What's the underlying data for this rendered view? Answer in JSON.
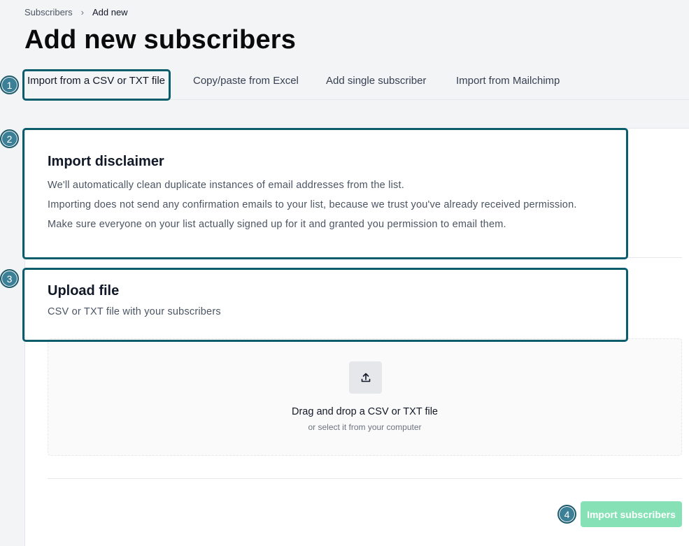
{
  "breadcrumb": {
    "parent": "Subscribers",
    "separator": "›",
    "current": "Add new"
  },
  "page": {
    "title": "Add new subscribers"
  },
  "tabs": [
    {
      "label": "Import from a CSV or TXT file"
    },
    {
      "label": "Copy/paste from Excel"
    },
    {
      "label": "Add single subscriber"
    },
    {
      "label": "Import from Mailchimp"
    }
  ],
  "disclaimer": {
    "title": "Import disclaimer",
    "lines": [
      "We'll automatically clean duplicate instances of email addresses from the list.",
      "Importing does not send any confirmation emails to your list, because we trust you've already received permission.",
      "Make sure everyone on your list actually signed up for it and granted you permission to email them."
    ]
  },
  "upload": {
    "title": "Upload file",
    "subtitle": "CSV or TXT file with your subscribers",
    "drop_title": "Drag and drop a CSV or TXT file",
    "drop_subtitle": "or select it from your computer",
    "icon": "upload-icon"
  },
  "actions": {
    "import_label": "Import subscribers",
    "import_color": "#86e2b6"
  },
  "annotations": [
    "1",
    "2",
    "3",
    "4"
  ],
  "colors": {
    "accent": "#0b5d6b",
    "badge": "#3b8096"
  }
}
